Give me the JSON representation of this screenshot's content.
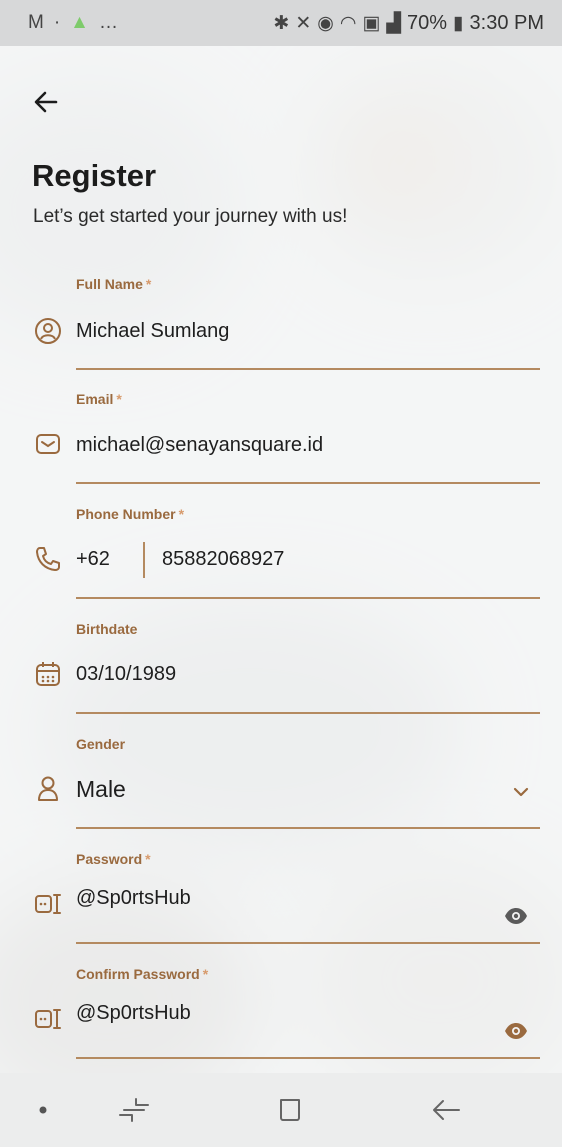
{
  "status_bar": {
    "left_icons": [
      "gmail-icon",
      "dot",
      "app-notification-icon",
      "more-dots"
    ],
    "battery": "70%",
    "time": "3:30 PM"
  },
  "header": {
    "title": "Register",
    "subtitle": "Let’s get started your journey with us!"
  },
  "form": {
    "full_name": {
      "label": "Full Name",
      "required": "*",
      "value": "Michael Sumlang",
      "icon": "user-circle-icon"
    },
    "email": {
      "label": "Email",
      "required": "*",
      "value": "michael@senayansquare.id",
      "icon": "mail-icon"
    },
    "phone": {
      "label": "Phone Number",
      "required": "*",
      "dial_code": "+62",
      "value": "85882068927",
      "icon": "phone-icon"
    },
    "birthdate": {
      "label": "Birthdate",
      "value": "03/10/1989",
      "icon": "calendar-icon"
    },
    "gender": {
      "label": "Gender",
      "value": "Male",
      "icon": "person-icon"
    },
    "password": {
      "label": "Password",
      "required": "*",
      "value": "@Sp0rtsHub",
      "icon": "key-icon"
    },
    "confirm_password": {
      "label": "Confirm Password",
      "required": "*",
      "value": "@Sp0rtsHub",
      "icon": "key-icon"
    }
  },
  "colors": {
    "accent": "#9a6a3f",
    "underline": "#b48a60",
    "required": "#d79a6c",
    "text": "#1e1e1e"
  },
  "nav_bar": {
    "icons": [
      "dot-icon",
      "recent-apps-icon",
      "home-icon",
      "back-icon"
    ]
  }
}
